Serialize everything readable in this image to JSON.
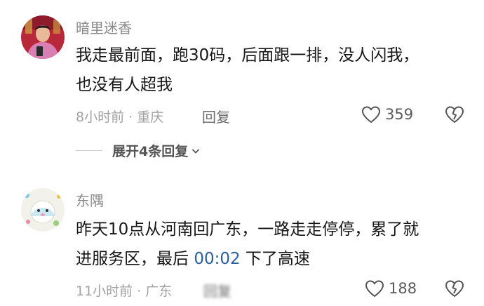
{
  "comments": [
    {
      "username": "暗里迷香",
      "text_lines": [
        "我走最前面，跑30码，后面跟一排，没人闪我，",
        "也没有人超我"
      ],
      "meta": "8小时前 · 重庆",
      "reply_label": "回复",
      "likes": "359",
      "expand_label": "展开4条回复"
    },
    {
      "username": "东隅",
      "text_line1": "昨天10点从河南回广东，一路走走停停，累了就",
      "text_line2_pre": "进服务区，最后 ",
      "timestamp_link": "00:02",
      "text_line2_post": " 下了高速",
      "meta": "11小时前 · 广东",
      "reply_label": "回复",
      "likes": "188"
    }
  ],
  "colors": {
    "timestamp_link": "#2a5f9e",
    "meta_text": "#a2a2a2",
    "username": "#8a8a8a"
  },
  "icons": {
    "like": "heart-outline-icon",
    "dislike": "broken-heart-icon",
    "expand": "chevron-down-icon"
  }
}
